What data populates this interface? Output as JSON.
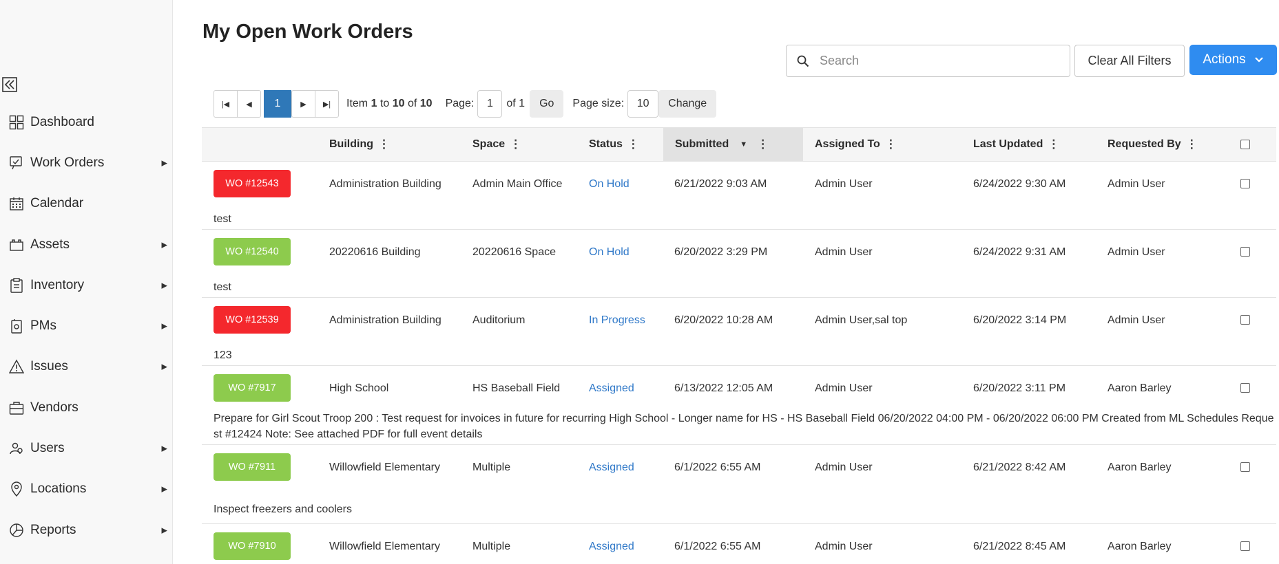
{
  "page_title": "My Open Work Orders",
  "sidebar": {
    "items": [
      {
        "label": "Dashboard",
        "icon": "dashboard-icon",
        "has_submenu": false
      },
      {
        "label": "Work Orders",
        "icon": "work-orders-icon",
        "has_submenu": true
      },
      {
        "label": "Calendar",
        "icon": "calendar-icon",
        "has_submenu": false
      },
      {
        "label": "Assets",
        "icon": "assets-icon",
        "has_submenu": true
      },
      {
        "label": "Inventory",
        "icon": "inventory-icon",
        "has_submenu": true
      },
      {
        "label": "PMs",
        "icon": "pms-icon",
        "has_submenu": true
      },
      {
        "label": "Issues",
        "icon": "warning-icon",
        "has_submenu": true
      },
      {
        "label": "Vendors",
        "icon": "briefcase-icon",
        "has_submenu": false
      },
      {
        "label": "Users",
        "icon": "users-icon",
        "has_submenu": true
      },
      {
        "label": "Locations",
        "icon": "location-pin-icon",
        "has_submenu": true
      },
      {
        "label": "Reports",
        "icon": "pie-chart-icon",
        "has_submenu": true
      }
    ]
  },
  "search": {
    "placeholder": "Search",
    "value": ""
  },
  "buttons": {
    "clear_filters": "Clear All Filters",
    "actions": "Actions"
  },
  "pager": {
    "current_page": "1",
    "item_prefix": "Item",
    "item_from": "1",
    "item_to_word": "to",
    "item_to": "10",
    "item_of_word": "of",
    "item_total": "10",
    "page_label": "Page:",
    "page_value": "1",
    "page_of": "of 1",
    "go": "Go",
    "size_label": "Page size:",
    "size_value": "10",
    "change": "Change"
  },
  "columns": {
    "building": "Building",
    "space": "Space",
    "status": "Status",
    "submitted": "Submitted",
    "assigned_to": "Assigned To",
    "last_updated": "Last Updated",
    "requested_by": "Requested By"
  },
  "rows": [
    {
      "wo": "WO #12543",
      "color": "#f4282d",
      "building": "Administration Building",
      "space": "Admin Main Office",
      "status": "On Hold",
      "submitted": "6/21/2022 9:03 AM",
      "assigned_to": "Admin User",
      "last_updated": "6/24/2022 9:30 AM",
      "requested_by": "Admin User",
      "description": "test"
    },
    {
      "wo": "WO #12540",
      "color": "#8dcb4d",
      "building": "20220616 Building",
      "space": "20220616 Space",
      "status": "On Hold",
      "submitted": "6/20/2022 3:29 PM",
      "assigned_to": "Admin User",
      "last_updated": "6/24/2022 9:31 AM",
      "requested_by": "Admin User",
      "description": "test"
    },
    {
      "wo": "WO #12539",
      "color": "#f4282d",
      "building": "Administration Building",
      "space": "Auditorium",
      "status": "In Progress",
      "submitted": "6/20/2022 10:28 AM",
      "assigned_to": "Admin User,sal top",
      "last_updated": "6/20/2022 3:14 PM",
      "requested_by": "Admin User",
      "description": "123"
    },
    {
      "wo": "WO #7917",
      "color": "#8dcb4d",
      "building": "High School",
      "space": "HS Baseball Field",
      "status": "Assigned",
      "submitted": "6/13/2022 12:05 AM",
      "assigned_to": "Admin User",
      "last_updated": "6/20/2022 3:11 PM",
      "requested_by": "Aaron Barley",
      "description": "Prepare for Girl Scout Troop 200 : Test request for invoices in future for recurring High School - Longer name for HS - HS Baseball Field 06/20/2022 04:00 PM - 06/20/2022 06:00 PM Created from ML Schedules Request #12424 Note: See attached PDF for full event details"
    },
    {
      "wo": "WO #7911",
      "color": "#8dcb4d",
      "building": "Willowfield Elementary",
      "space": "Multiple",
      "status": "Assigned",
      "submitted": "6/1/2022 6:55 AM",
      "assigned_to": "Admin User",
      "last_updated": "6/21/2022 8:42 AM",
      "requested_by": "Aaron Barley",
      "description": "Inspect freezers and coolers"
    },
    {
      "wo": "WO #7910",
      "color": "#8dcb4d",
      "building": "Willowfield Elementary",
      "space": "Multiple",
      "status": "Assigned",
      "submitted": "6/1/2022 6:55 AM",
      "assigned_to": "Admin User",
      "last_updated": "6/21/2022 8:45 AM",
      "requested_by": "Aaron Barley",
      "description": ""
    }
  ]
}
